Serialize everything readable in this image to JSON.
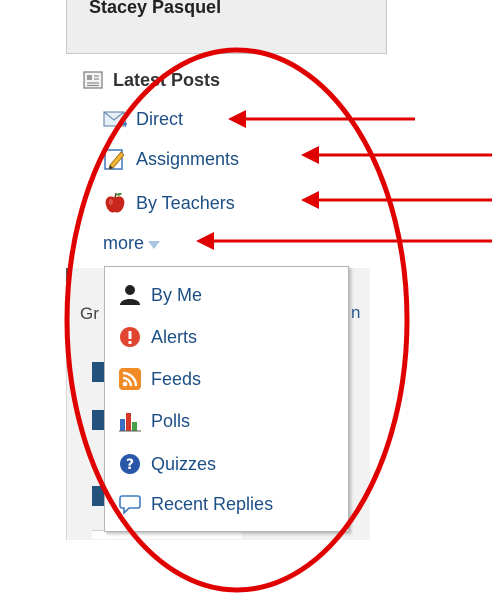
{
  "user": {
    "name": "Stacey Pasquel"
  },
  "latest_posts": {
    "title": "Latest Posts",
    "items": [
      {
        "label": "Direct",
        "icon": "envelope-icon"
      },
      {
        "label": "Assignments",
        "icon": "pencil-note-icon"
      },
      {
        "label": "By Teachers",
        "icon": "apple-icon"
      }
    ],
    "more_label": "more"
  },
  "more_menu": {
    "items": [
      {
        "label": "By Me",
        "icon": "person-icon"
      },
      {
        "label": "Alerts",
        "icon": "alert-icon"
      },
      {
        "label": "Feeds",
        "icon": "rss-icon"
      },
      {
        "label": "Polls",
        "icon": "bar-chart-icon"
      },
      {
        "label": "Quizzes",
        "icon": "question-icon"
      },
      {
        "label": "Recent Replies",
        "icon": "speech-bubble-icon"
      }
    ]
  },
  "background_panel": {
    "partial_left": "Gr",
    "partial_right": "n"
  },
  "annotation_colors": {
    "ellipse": "#e00000",
    "arrows": "#e00000"
  }
}
